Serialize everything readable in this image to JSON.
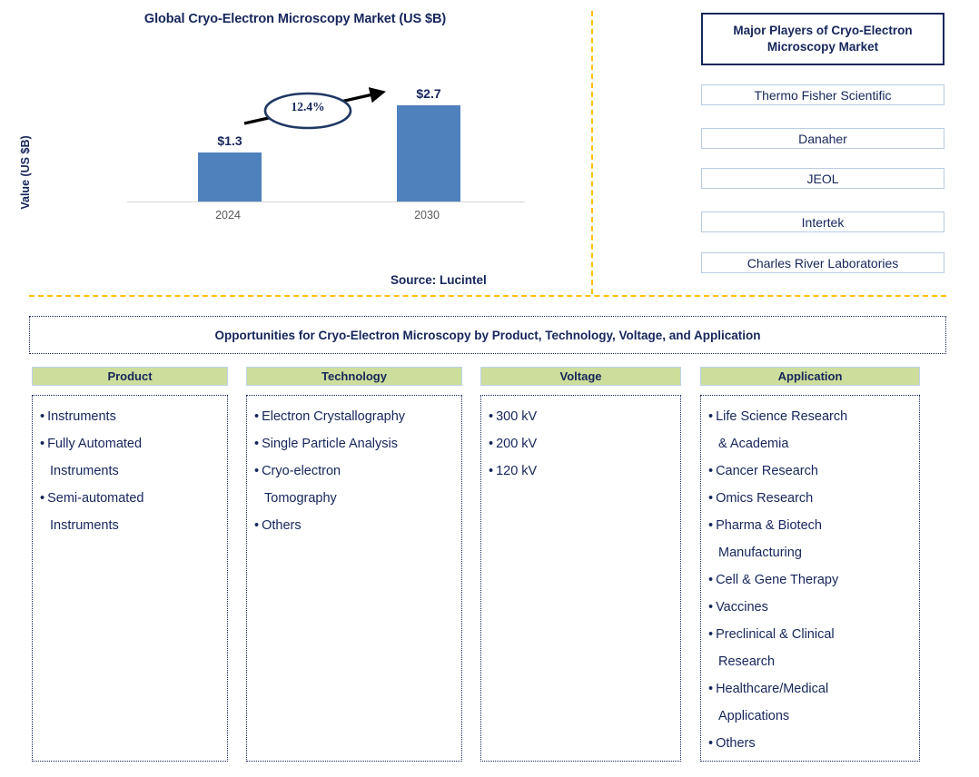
{
  "chart_panel": {
    "title": "Global Cryo-Electron Microscopy Market (US $B)",
    "source": "Source: Lucintel"
  },
  "chart_data": {
    "type": "bar",
    "title": "Global Cryo-Electron Microscopy Market (US $B)",
    "categories": [
      "2024",
      "2030"
    ],
    "values": [
      1.3,
      2.7
    ],
    "value_labels": [
      "$1.3",
      "$2.7"
    ],
    "xlabel": "",
    "ylabel": "Value (US $B)",
    "ylim": [
      0,
      3.0
    ],
    "grid": false,
    "legend": "none",
    "bar_color": "#4f81bd",
    "annotations": [
      {
        "type": "cagr-arrow",
        "label": "12.4%",
        "from": "2024",
        "to": "2030"
      }
    ]
  },
  "players_panel": {
    "header": "Major Players of Cryo-Electron Microscopy Market",
    "items": [
      "Thermo Fisher Scientific",
      "Danaher",
      "JEOL",
      "Intertek",
      "Charles River Laboratories"
    ]
  },
  "opportunities": {
    "banner": "Opportunities for Cryo-Electron Microscopy by Product, Technology, Voltage, and Application",
    "columns": [
      {
        "header": "Product",
        "items": [
          "Instruments",
          "Fully Automated\nInstruments",
          "Semi-automated\nInstruments"
        ]
      },
      {
        "header": "Technology",
        "items": [
          "Electron Crystallography",
          "Single Particle Analysis",
          "Cryo-electron\nTomography",
          "Others"
        ]
      },
      {
        "header": "Voltage",
        "items": [
          "300 kV",
          "200 kV",
          "120 kV"
        ]
      },
      {
        "header": "Application",
        "items": [
          "Life Science Research\n& Academia",
          "Cancer Research",
          "Omics Research",
          "Pharma & Biotech\nManufacturing",
          "Cell & Gene Therapy",
          "Vaccines",
          "Preclinical & Clinical\nResearch",
          "Healthcare/Medical\nApplications",
          "Others"
        ]
      }
    ]
  },
  "colors": {
    "navy": "#15265c",
    "bar_blue": "#4f81bd",
    "divider_gold": "#ffc000",
    "header_green": "#cdde9c",
    "player_border": "#b8cce4"
  }
}
